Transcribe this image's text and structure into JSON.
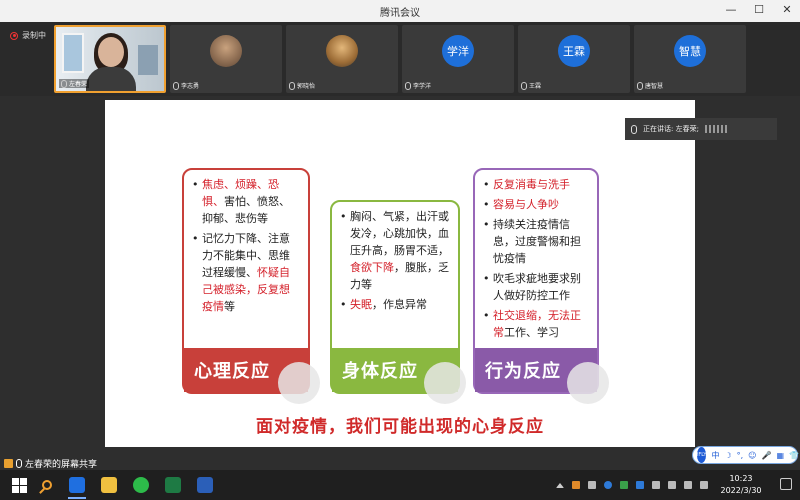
{
  "window": {
    "title": "腾讯会议",
    "minimize": "—",
    "maximize": "☐",
    "close": "✕"
  },
  "recording": {
    "label": "录制中"
  },
  "participants": [
    {
      "name": "左春荣",
      "kind": "camera"
    },
    {
      "name": "李志勇",
      "kind": "photo"
    },
    {
      "name": "郭晓怡",
      "kind": "photo"
    },
    {
      "name": "李学洋",
      "kind": "avatar",
      "avatar_text": "学洋"
    },
    {
      "name": "王霖",
      "kind": "avatar",
      "avatar_text": "王霖"
    },
    {
      "name": "唐智慧",
      "kind": "avatar",
      "avatar_text": "智慧"
    }
  ],
  "speaking": {
    "label": "正在讲话: 左春荣;"
  },
  "slide": {
    "psych": {
      "items": [
        {
          "parts": [
            {
              "text": "焦虑、烦躁、恐惧、",
              "red": true
            },
            {
              "text": "害怕、愤怒、抑郁、悲伤等",
              "red": false
            }
          ]
        },
        {
          "parts": [
            {
              "text": "记忆力下降、注意力不能集中、思维过程缓慢、",
              "red": false
            },
            {
              "text": "怀疑自己被感染，反复想疫情",
              "red": true
            },
            {
              "text": "等",
              "red": false
            }
          ]
        }
      ],
      "tag": "心理反应"
    },
    "body": {
      "items": [
        {
          "parts": [
            {
              "text": "胸闷、气紧，出汗或发冷，心跳加快，血压升高，肠胃不适，",
              "red": false
            },
            {
              "text": "食欲下降",
              "red": true
            },
            {
              "text": "，腹胀，乏力等",
              "red": false
            }
          ]
        },
        {
          "parts": [
            {
              "text": "失眠",
              "red": true
            },
            {
              "text": "，作息异常",
              "red": false
            }
          ]
        }
      ],
      "tag": "身体反应"
    },
    "behave": {
      "items": [
        {
          "parts": [
            {
              "text": "反复消毒与洗手",
              "red": true
            }
          ]
        },
        {
          "parts": [
            {
              "text": "容易与人争吵",
              "red": true
            }
          ]
        },
        {
          "parts": [
            {
              "text": "持续关注疫情信息，过度警惕和担忧疫情",
              "red": false
            }
          ]
        },
        {
          "parts": [
            {
              "text": "吹毛求疵地要求别人做好防控工作",
              "red": false
            }
          ]
        },
        {
          "parts": [
            {
              "text": "社交退缩，无法正常",
              "red": true
            },
            {
              "text": "工作、学习",
              "red": false
            }
          ]
        }
      ],
      "tag": "行为反应"
    },
    "caption": "面对疫情，我们可能出现的心身反应"
  },
  "share": {
    "label": "左春荣的屏幕共享"
  },
  "ime": {
    "logo": "iFLY",
    "items": [
      "中",
      "☽",
      "°,",
      "☺",
      "🎤",
      "▦",
      "👕",
      "⚙"
    ]
  },
  "taskbar": {
    "clock_time": "10:23",
    "clock_date": "2022/3/30"
  },
  "colors": {
    "psych": "#c8403a",
    "body": "#8ab840",
    "behave": "#8a5aa8",
    "caption": "#d02a2a"
  }
}
